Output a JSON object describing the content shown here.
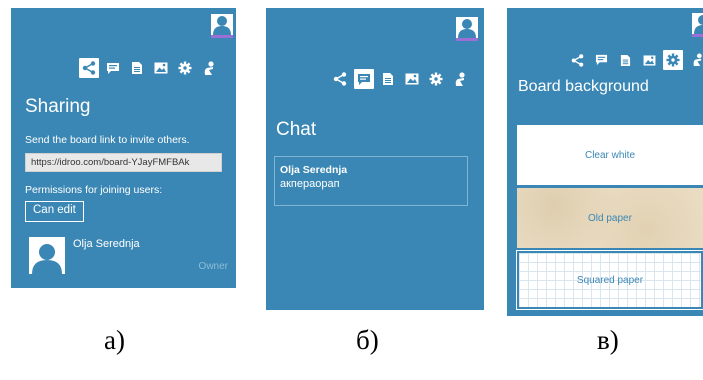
{
  "colors": {
    "panel": "#3a87b5",
    "accent": "#9b6fd6",
    "field": "#e8e8e8"
  },
  "icons": [
    "user-icon",
    "share-icon",
    "chat-icon",
    "document-icon",
    "image-icon",
    "gear-icon",
    "hand-icon"
  ],
  "panel_a": {
    "title": "Sharing",
    "invite_text": "Send the board link to invite others.",
    "board_link": "https://idroo.com/board-YJayFMFBAk",
    "permissions_label": "Permissions for joining users:",
    "permission_value": "Can edit",
    "user_name": "Olja Serednja",
    "user_role": "Owner",
    "active_tab": "share"
  },
  "panel_b": {
    "title": "Chat",
    "message_author": "Olja Serednja",
    "message_text": "акпераорап",
    "active_tab": "chat"
  },
  "panel_c": {
    "title": "Board background",
    "options": [
      "Clear white",
      "Old paper",
      "Squared paper"
    ],
    "active_tab": "settings"
  },
  "captions": {
    "a": "а)",
    "b": "б)",
    "c": "в)"
  }
}
